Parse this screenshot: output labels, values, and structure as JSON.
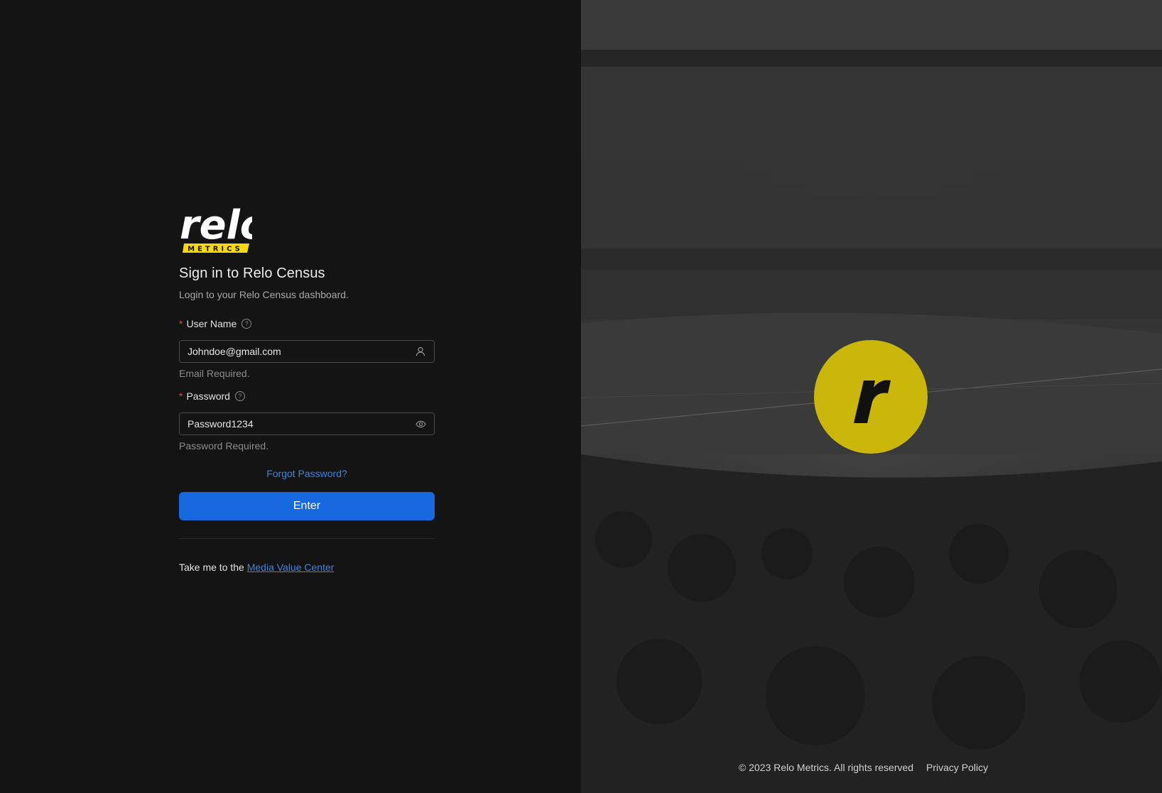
{
  "brand": {
    "logo_word": "relo",
    "logo_tag": "METRICS",
    "logo_tag_color": "#f5d90a"
  },
  "login": {
    "title": "Sign in to Relo Census",
    "subtitle": "Login to your Relo Census dashboard.",
    "username": {
      "required_mark": "*",
      "label": "User Name",
      "value": "Johndoe@gmail.com",
      "suffix_icon": "user-icon",
      "help_text": "Email Required."
    },
    "password": {
      "required_mark": "*",
      "label": "Password",
      "value": "Password1234",
      "suffix_icon": "eye-icon",
      "help_text": "Password Required."
    },
    "forgot_label": "Forgot Password?",
    "submit_label": "Enter",
    "media_prefix": "Take me to the",
    "media_link": "Media Value Center"
  },
  "footer": {
    "copyright": "© 2023 Relo Metrics. All rights reserved",
    "privacy": "Privacy Policy"
  },
  "colors": {
    "background": "#141415",
    "primary": "#1868e0",
    "link": "#3f82e8",
    "required": "#e4473f",
    "badge": "#cbb70a"
  }
}
